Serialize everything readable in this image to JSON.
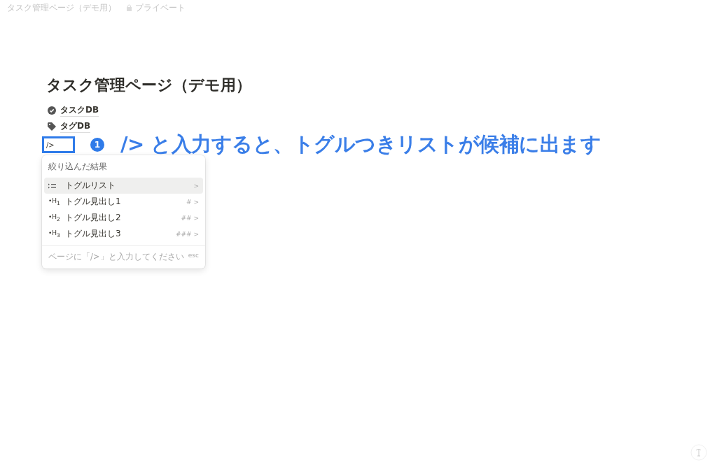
{
  "topbar": {
    "breadcrumb": "タスク管理ページ（デモ用）",
    "privacy": "プライベート"
  },
  "page": {
    "title": "タスク管理ページ（デモ用）",
    "links": [
      {
        "kind": "check",
        "label": "タスクDB"
      },
      {
        "kind": "tag",
        "label": "タグDB"
      }
    ],
    "input": {
      "value": "/>"
    }
  },
  "annotation": {
    "number": "1",
    "text": "/> と入力すると、トグルつきリストが候補に出ます"
  },
  "menu": {
    "header": "絞り込んだ結果",
    "items": [
      {
        "kind": "list",
        "label": "トグルリスト",
        "shortcut": ">",
        "selected": true
      },
      {
        "kind": "heading",
        "icon_label": "•H$_{1}$",
        "label": "トグル見出し1",
        "shortcut": "# >",
        "selected": false
      },
      {
        "kind": "heading",
        "icon_label": "•H$_{2}$",
        "label": "トグル見出し2",
        "shortcut": "## >",
        "selected": false
      },
      {
        "kind": "heading",
        "icon_label": "•H$_{3}$",
        "label": "トグル見出し3",
        "shortcut": "### >",
        "selected": false
      }
    ],
    "footer": "ページに「/>」と入力してください",
    "footer_key": "esc"
  }
}
